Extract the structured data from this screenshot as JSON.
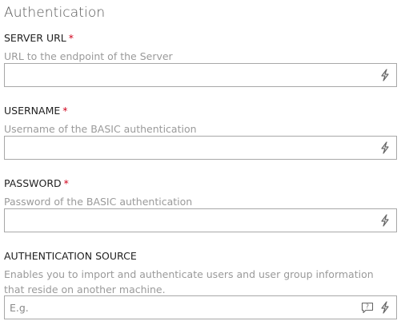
{
  "section": {
    "title": "Authentication"
  },
  "fields": [
    {
      "label": "SERVER URL",
      "required_mark": "*",
      "description": "URL to the endpoint of the Server",
      "value": "",
      "placeholder": "",
      "icons": [
        "lightning-icon"
      ]
    },
    {
      "label": "USERNAME",
      "required_mark": "*",
      "description": "Username of the BASIC authentication",
      "value": "",
      "placeholder": "",
      "icons": [
        "lightning-icon"
      ]
    },
    {
      "label": "PASSWORD",
      "required_mark": "*",
      "description": "Password of the BASIC authentication",
      "value": "",
      "placeholder": "",
      "icons": [
        "lightning-icon"
      ]
    },
    {
      "label": "AUTHENTICATION SOURCE",
      "required_mark": "",
      "description": "Enables you to import and authenticate users and user group information that reside on another machine.",
      "value": "",
      "placeholder": "E.g.",
      "icons": [
        "help-bubble-icon",
        "lightning-icon"
      ]
    }
  ],
  "colors": {
    "required": "#d0021b",
    "border": "#a8a8a8",
    "description": "#9a9a9a"
  }
}
